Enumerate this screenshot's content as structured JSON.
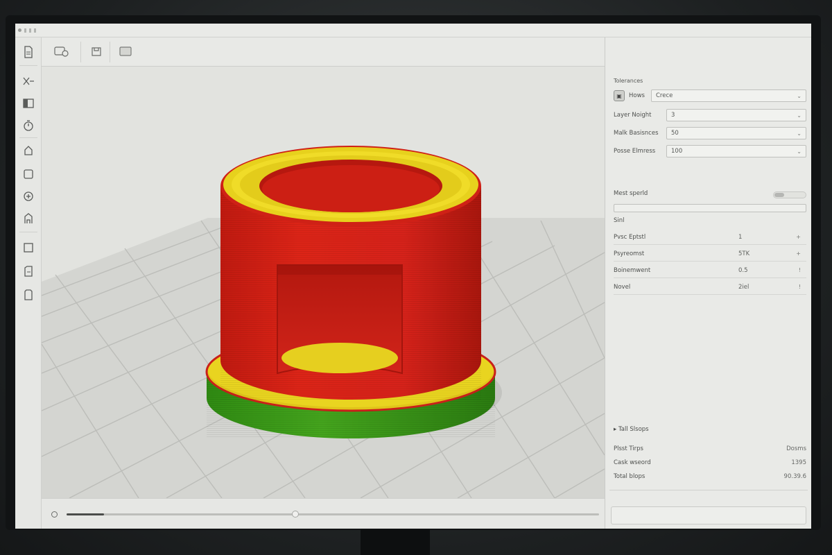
{
  "titlebar": {
    "label": ""
  },
  "left_toolbar": {
    "icons": [
      "file-icon",
      "transform-icon",
      "panel-icon",
      "timer-icon",
      "support-icon",
      "cube-icon",
      "add-icon",
      "paint-icon",
      "square-icon",
      "cabinet-icon",
      "box-icon"
    ]
  },
  "top_toolbar": {
    "icons": [
      "open-icon",
      "save-icon",
      "frame-icon"
    ]
  },
  "panel": {
    "header": "Tolerances",
    "preset": {
      "icon": "profile-icon",
      "label": "Hows",
      "value": "Crece"
    },
    "rows": [
      {
        "label": "Layer Noight",
        "value": "3"
      },
      {
        "label": "Malk Basisnces",
        "value": "50"
      },
      {
        "label": "Posse Elmress",
        "value": "100"
      }
    ],
    "toggle_label": "Mest sperld",
    "section_label": "Sinl",
    "settings": [
      {
        "label": "Pvsc Eptstl",
        "value": "1",
        "action": "+"
      },
      {
        "label": "Psyreomst",
        "value": "5TK",
        "action": "+"
      },
      {
        "label": "Boinemwent",
        "value": "0.5",
        "action": "!"
      },
      {
        "label": "Novel",
        "value": "2iel",
        "action": "!"
      }
    ],
    "stats_header": "Tall Slsops",
    "stats": [
      {
        "label": "Plsst Tirps",
        "value": "Dosms"
      },
      {
        "label": "Cask wseord",
        "value": "1395"
      },
      {
        "label": "Total blops",
        "value": "90.39.6"
      }
    ]
  },
  "slider": {
    "progress": 0.07,
    "thumb": 0.43
  },
  "colors": {
    "wall": "#d21f14",
    "infill": "#e8d21c",
    "base": "#3c9a1a",
    "bed": "#d7d8d4"
  }
}
